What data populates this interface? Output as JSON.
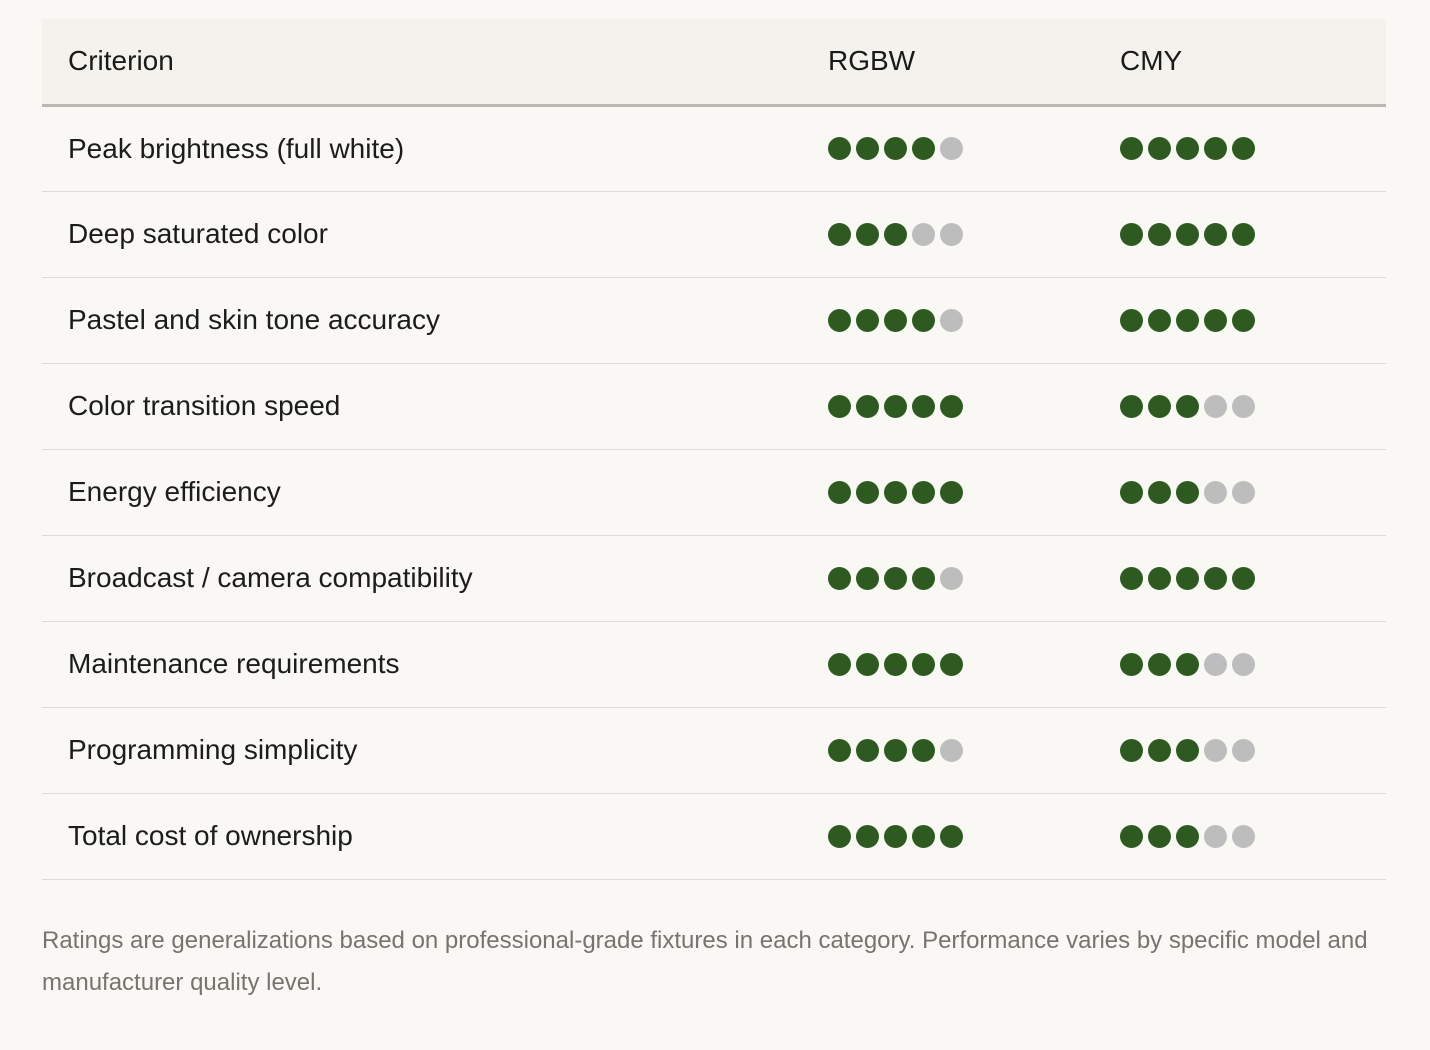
{
  "colors": {
    "filled": "#2e5a21",
    "empty": "#bdbdbd",
    "header_bg": "#f3f2ed",
    "page_bg": "#f9f8f4"
  },
  "header": {
    "criterion": "Criterion",
    "rgbw": "RGBW",
    "cmy": "CMY"
  },
  "max_rating": 5,
  "rows": [
    {
      "criterion": "Peak brightness (full white)",
      "rgbw": 4,
      "cmy": 5
    },
    {
      "criterion": "Deep saturated color",
      "rgbw": 3,
      "cmy": 5
    },
    {
      "criterion": "Pastel and skin tone accuracy",
      "rgbw": 4,
      "cmy": 5
    },
    {
      "criterion": "Color transition speed",
      "rgbw": 5,
      "cmy": 3
    },
    {
      "criterion": "Energy efficiency",
      "rgbw": 5,
      "cmy": 3
    },
    {
      "criterion": "Broadcast / camera compatibility",
      "rgbw": 4,
      "cmy": 5
    },
    {
      "criterion": "Maintenance requirements",
      "rgbw": 5,
      "cmy": 3
    },
    {
      "criterion": "Programming simplicity",
      "rgbw": 4,
      "cmy": 3
    },
    {
      "criterion": "Total cost of ownership",
      "rgbw": 5,
      "cmy": 3
    }
  ],
  "footnote": "Ratings are generalizations based on professional-grade fixtures in each category. Performance varies by specific model and manufacturer quality level."
}
